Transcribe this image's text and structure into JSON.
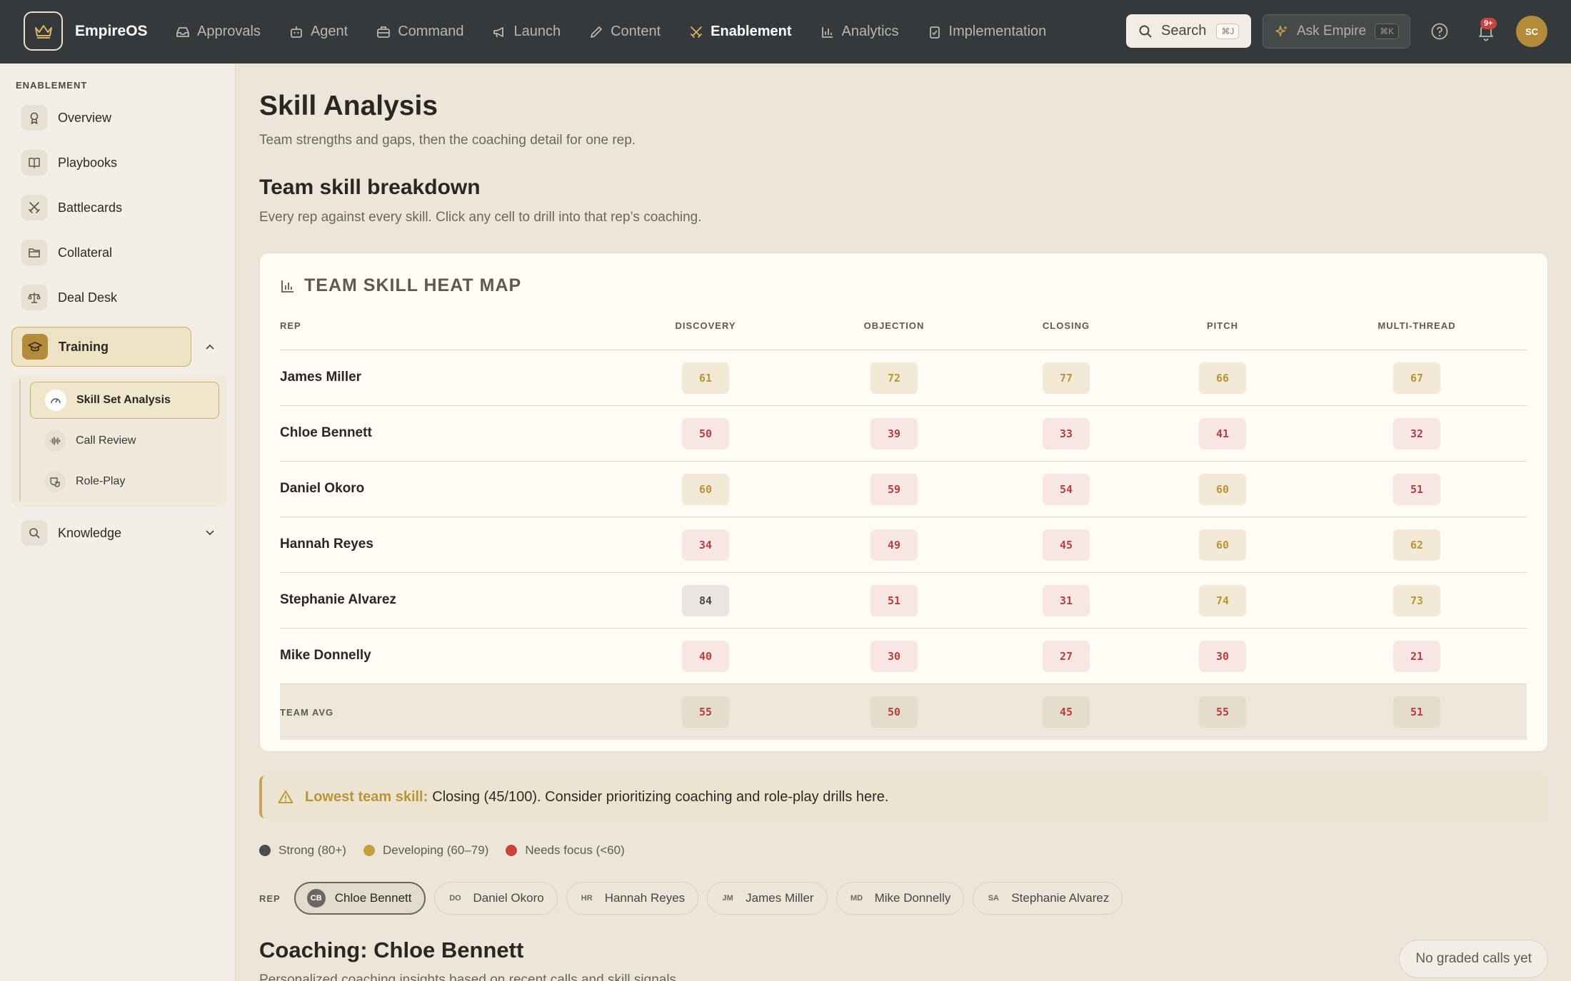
{
  "app": {
    "name": "EmpireOS"
  },
  "nav": [
    {
      "label": "Approvals",
      "icon": "inbox-icon"
    },
    {
      "label": "Agent",
      "icon": "robot-icon"
    },
    {
      "label": "Command",
      "icon": "briefcase-icon"
    },
    {
      "label": "Launch",
      "icon": "megaphone-icon"
    },
    {
      "label": "Content",
      "icon": "pencil-icon"
    },
    {
      "label": "Enablement",
      "icon": "swords-icon",
      "active": true
    },
    {
      "label": "Analytics",
      "icon": "bar-chart-icon"
    },
    {
      "label": "Implementation",
      "icon": "clipboard-icon"
    }
  ],
  "topbar": {
    "search_label": "Search",
    "search_shortcut": "⌘J",
    "ask_label": "Ask Empire",
    "ask_shortcut": "⌘K",
    "notifications_badge": "9+",
    "avatar_initials": "SC"
  },
  "sidebar": {
    "heading": "ENABLEMENT",
    "items": [
      {
        "label": "Overview",
        "icon": "ribbon-icon"
      },
      {
        "label": "Playbooks",
        "icon": "book-icon"
      },
      {
        "label": "Battlecards",
        "icon": "swords-icon"
      },
      {
        "label": "Collateral",
        "icon": "folder-icon"
      },
      {
        "label": "Deal Desk",
        "icon": "scale-icon"
      },
      {
        "label": "Training",
        "icon": "graduation-cap-icon",
        "expanded": true
      },
      {
        "label": "Knowledge",
        "icon": "search-icon",
        "expanded": false
      }
    ],
    "training_children": [
      {
        "label": "Skill Set Analysis",
        "icon": "gauge-icon",
        "active": true
      },
      {
        "label": "Call Review",
        "icon": "waveform-icon"
      },
      {
        "label": "Role-Play",
        "icon": "theater-icon"
      }
    ]
  },
  "page": {
    "title": "Skill Analysis",
    "subtitle": "Team strengths and gaps, then the coaching detail for one rep.",
    "section_title": "Team skill breakdown",
    "section_subtitle": "Every rep against every skill. Click any cell to drill into that rep’s coaching."
  },
  "heatmap": {
    "title": "TEAM SKILL HEAT MAP",
    "rep_header": "REP",
    "columns": [
      "DISCOVERY",
      "OBJECTION",
      "CLOSING",
      "PITCH",
      "MULTI-THREAD"
    ],
    "rows": [
      {
        "rep": "James Miller",
        "scores": [
          "61",
          "72",
          "77",
          "66",
          "67"
        ]
      },
      {
        "rep": "Chloe Bennett",
        "scores": [
          "50",
          "39",
          "33",
          "41",
          "32"
        ]
      },
      {
        "rep": "Daniel Okoro",
        "scores": [
          "60",
          "59",
          "54",
          "60",
          "51"
        ]
      },
      {
        "rep": "Hannah Reyes",
        "scores": [
          "34",
          "49",
          "45",
          "60",
          "62"
        ]
      },
      {
        "rep": "Stephanie Alvarez",
        "scores": [
          "84",
          "51",
          "31",
          "74",
          "73"
        ]
      },
      {
        "rep": "Mike Donnelly",
        "scores": [
          "40",
          "30",
          "27",
          "30",
          "21"
        ]
      }
    ],
    "avg_label": "TEAM AVG",
    "avg_scores": [
      "55",
      "50",
      "45",
      "55",
      "51"
    ]
  },
  "alert": {
    "strong": "Lowest team skill:",
    "text": "Closing (45/100). Consider prioritizing coaching and role-play drills here."
  },
  "legend": [
    {
      "label": "Strong (80+)",
      "color": "#4a4c4f"
    },
    {
      "label": "Developing (60–79)",
      "color": "#c5a03e"
    },
    {
      "label": "Needs focus (<60)",
      "color": "#c9423d"
    }
  ],
  "rep_selector": {
    "label": "REP",
    "chips": [
      {
        "initials": "CB",
        "name": "Chloe Bennett",
        "active": true
      },
      {
        "initials": "DO",
        "name": "Daniel Okoro"
      },
      {
        "initials": "HR",
        "name": "Hannah Reyes"
      },
      {
        "initials": "JM",
        "name": "James Miller"
      },
      {
        "initials": "MD",
        "name": "Mike Donnelly"
      },
      {
        "initials": "SA",
        "name": "Stephanie Alvarez"
      }
    ]
  },
  "coaching": {
    "title": "Coaching: Chloe Bennett",
    "subtitle": "Personalized coaching insights based on recent calls and skill signals.",
    "status": "No graded calls yet"
  },
  "colors": {
    "accent": "#b48b3a",
    "topbar": "#36393b",
    "developing": "#b8953a",
    "needs_focus": "#b3423f",
    "strong": "#4a4844"
  }
}
